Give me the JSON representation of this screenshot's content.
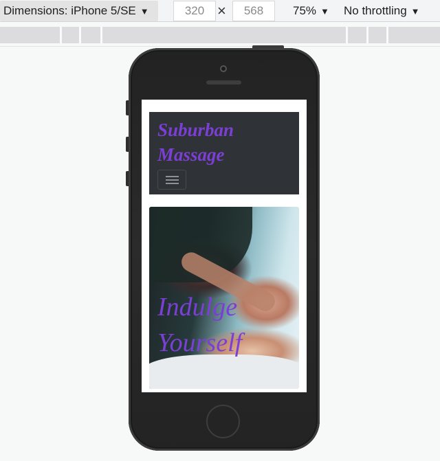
{
  "toolbar": {
    "device_label": "Dimensions: iPhone 5/SE",
    "width": "320",
    "height": "568",
    "times": "×",
    "zoom": "75%",
    "throttling": "No throttling",
    "caret": "▼"
  },
  "site": {
    "brand_line1": "Suburban",
    "brand_line2": "Massage",
    "hero_line1": "Indulge",
    "hero_line2": "Yourself",
    "accent_color": "#7b3fd4"
  }
}
